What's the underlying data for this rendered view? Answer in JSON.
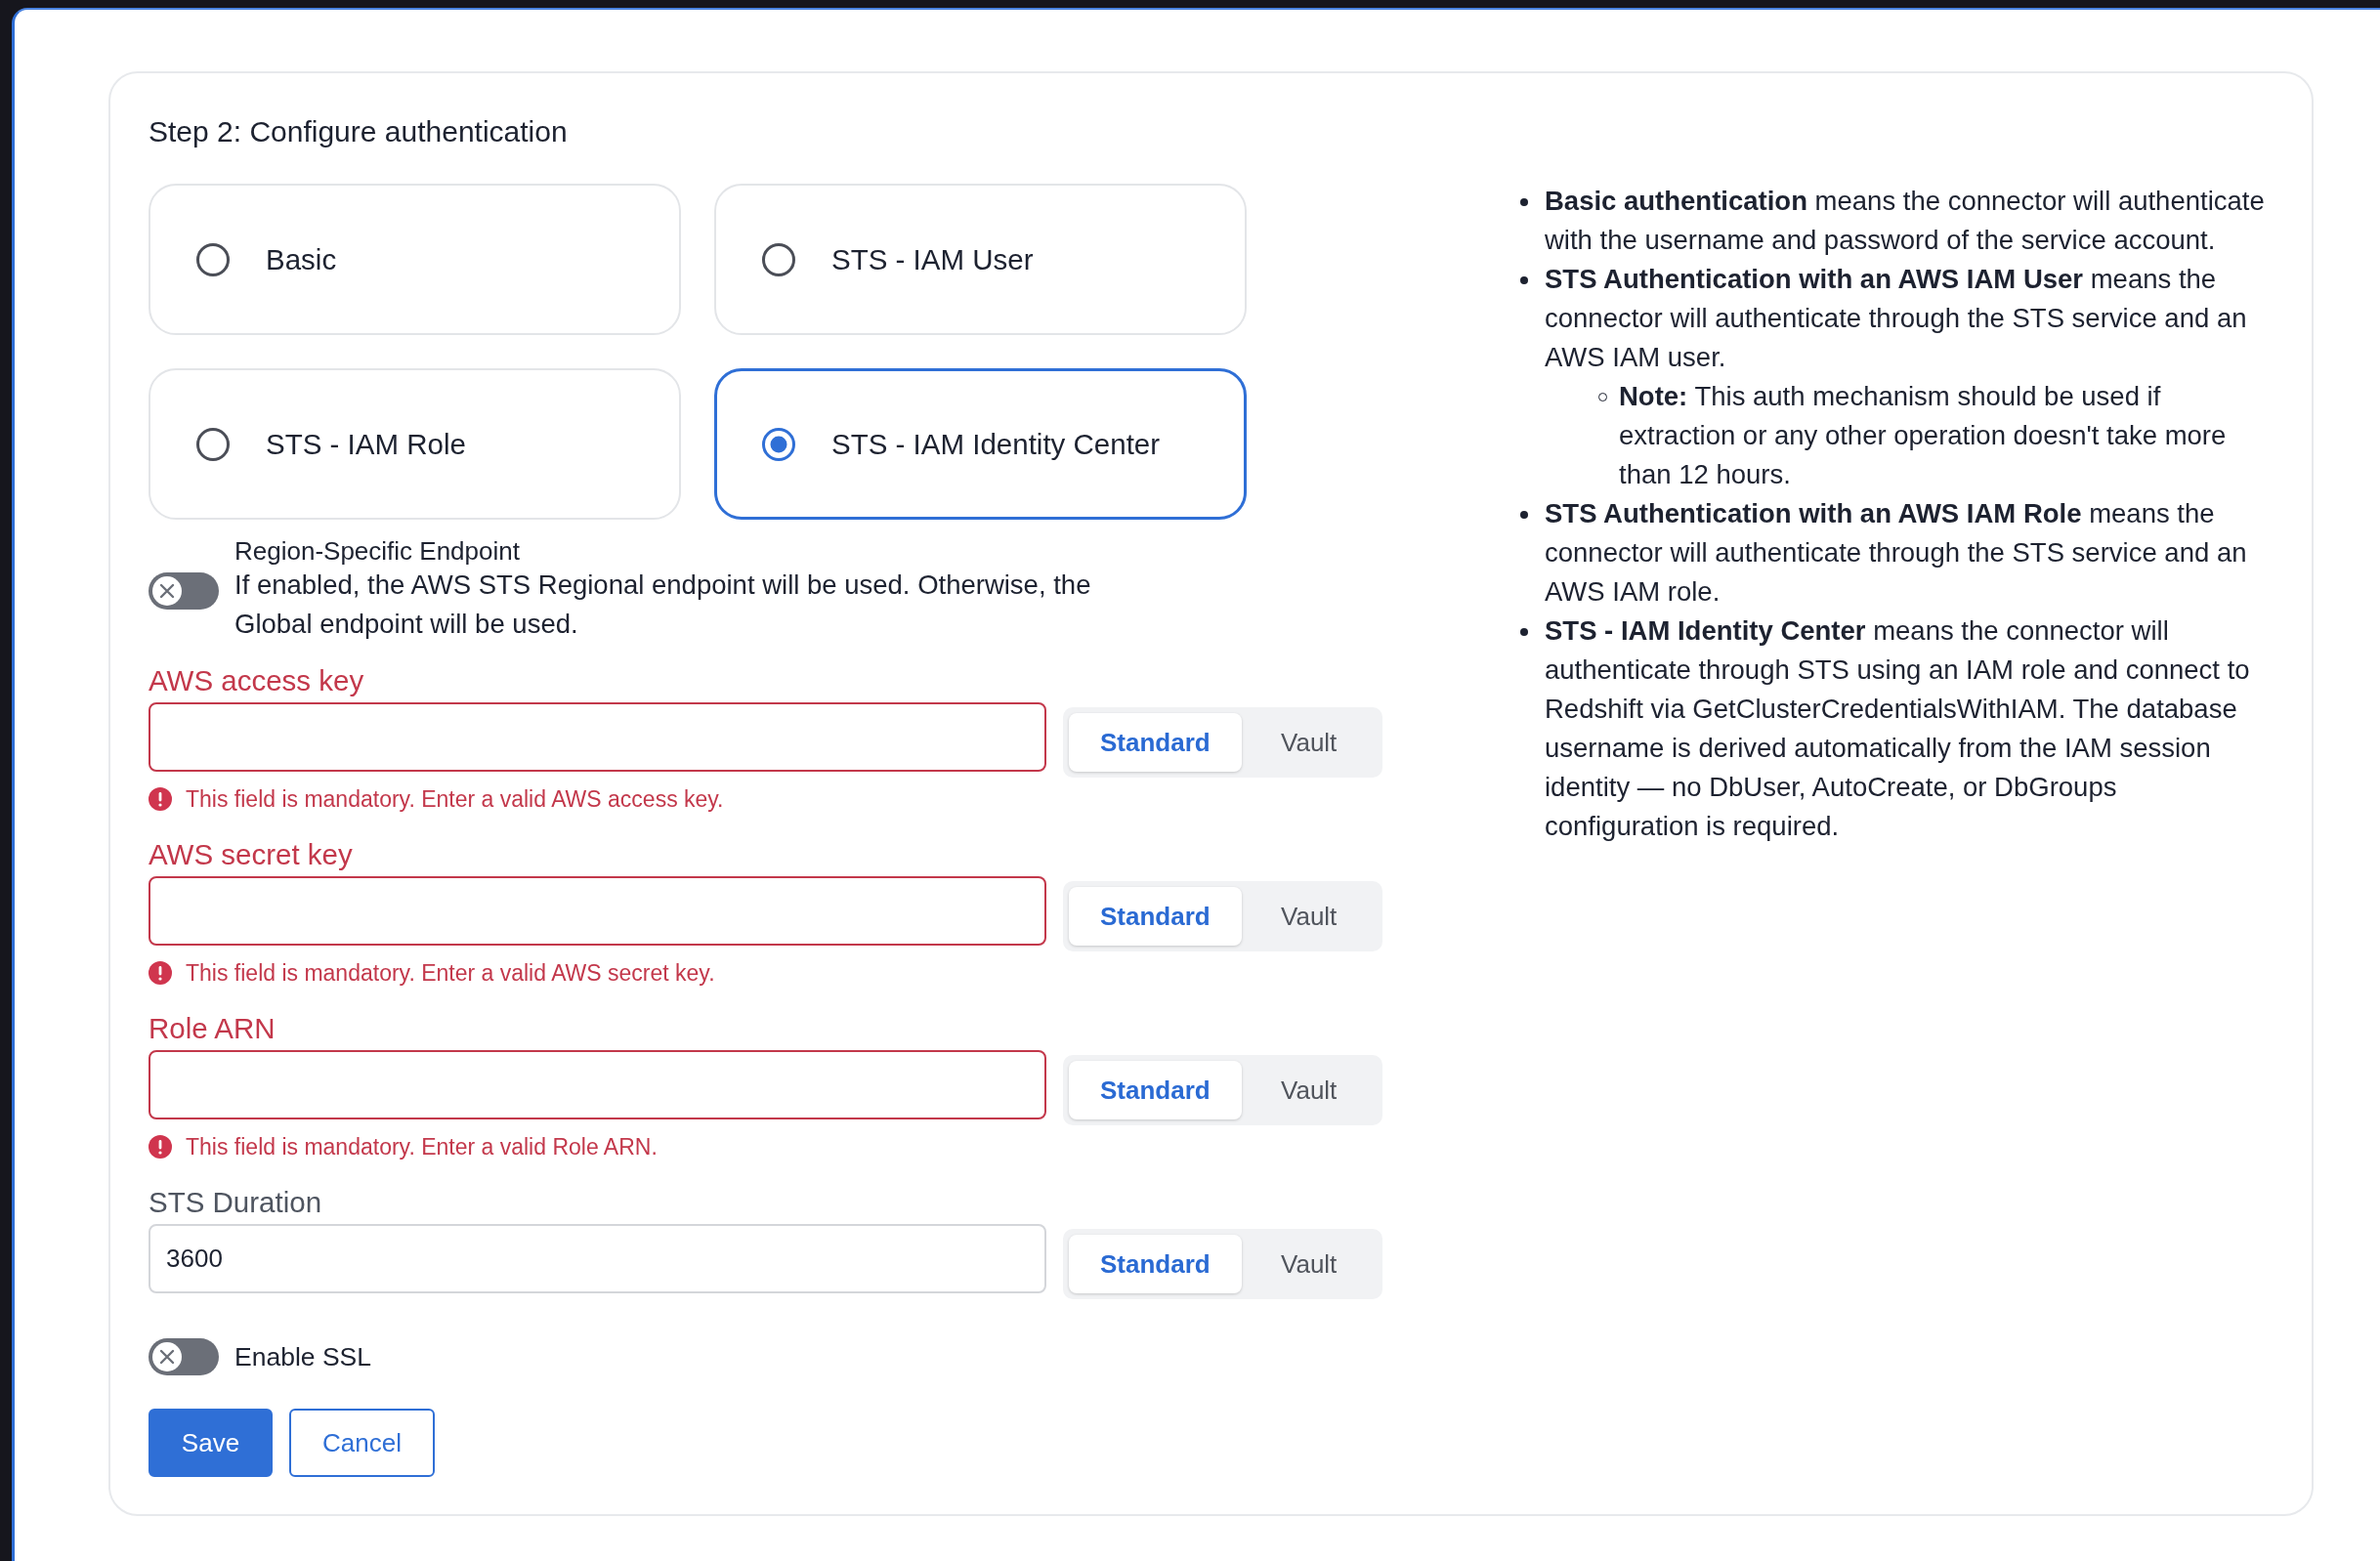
{
  "step_title": "Step 2: Configure authentication",
  "auth_options": [
    {
      "label": "Basic",
      "selected": false
    },
    {
      "label": "STS - IAM User",
      "selected": false
    },
    {
      "label": "STS - IAM Role",
      "selected": false
    },
    {
      "label": "STS - IAM Identity Center",
      "selected": true
    }
  ],
  "region_endpoint": {
    "title": "Region-Specific Endpoint",
    "description": "If enabled, the AWS STS Regional endpoint will be used. Otherwise, the Global endpoint will be used.",
    "on": false
  },
  "fields": [
    {
      "label": "AWS access key",
      "invalid": true,
      "error": "This field is mandatory. Enter a valid AWS access key.",
      "source_options": [
        {
          "label": "Standard",
          "selected": true
        },
        {
          "label": "Vault",
          "selected": false
        }
      ]
    },
    {
      "label": "AWS secret key",
      "invalid": true,
      "error": "This field is mandatory. Enter a valid AWS secret key.",
      "source_options": [
        {
          "label": "Standard",
          "selected": true
        },
        {
          "label": "Vault",
          "selected": false
        }
      ]
    },
    {
      "label": "Role ARN",
      "invalid": true,
      "error": "This field is mandatory. Enter a valid Role ARN.",
      "source_options": [
        {
          "label": "Standard",
          "selected": true
        },
        {
          "label": "Vault",
          "selected": false
        }
      ]
    },
    {
      "label": "STS Duration",
      "invalid": false,
      "value": "3600",
      "source_options": [
        {
          "label": "Standard",
          "selected": true
        },
        {
          "label": "Vault",
          "selected": false
        }
      ]
    }
  ],
  "ssl": {
    "label": "Enable SSL",
    "on": false
  },
  "buttons": [
    {
      "label": "Save",
      "kind": "primary"
    },
    {
      "label": "Cancel",
      "kind": "secondary"
    }
  ],
  "help": [
    {
      "text": "**Basic authentication** means the connector will authenticate with the username and password of the service account."
    },
    {
      "text": "**STS Authentication with an AWS IAM User** means the connector will authenticate through the STS service and an AWS IAM user.",
      "children": [
        {
          "text": "**Note:** This auth mechanism should be used if extraction or any other operation doesn't take more than 12 hours."
        }
      ]
    },
    {
      "text": "**STS Authentication with an AWS IAM Role** means the connector will authenticate through the STS service and an AWS IAM role."
    },
    {
      "text": "**STS - IAM Identity Center** means the connector will authenticate through STS using an IAM role and connect to Redshift via GetClusterCredentialsWithIAM. The database username is derived automatically from the IAM session identity — no DbUser, AutoCreate, or DbGroups configuration is required."
    }
  ]
}
